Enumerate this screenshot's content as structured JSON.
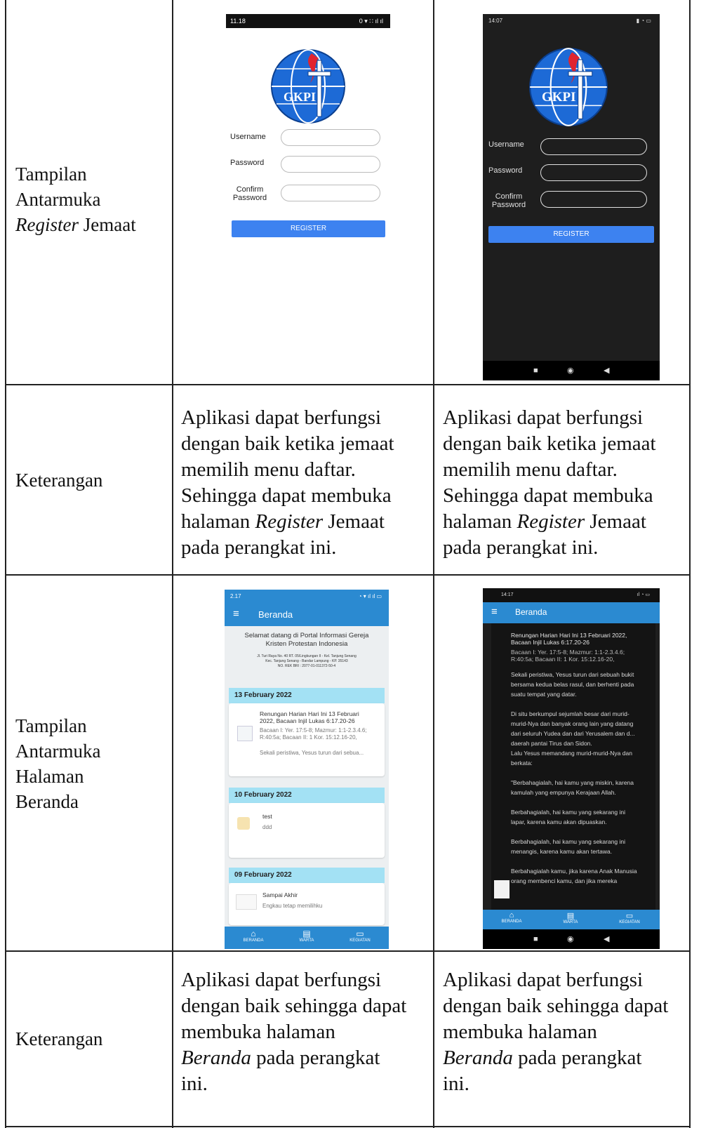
{
  "rows": [
    {
      "label_line1": "Tampilan",
      "label_line2": "Antarmuka",
      "label_line3_italic": "Register",
      "label_line3_rest": " Jemaat"
    },
    {
      "label": "Keterangan",
      "desc_lines": [
        "Aplikasi dapat berfungsi",
        "dengan baik ketika jemaat",
        "memilih menu daftar.",
        "Sehingga dapat membuka"
      ],
      "desc_last_prefix": "halaman ",
      "desc_last_italic": "Register",
      "desc_last_suffix": " Jemaat",
      "desc_final": "pada perangkat ini."
    },
    {
      "label_lines": [
        "Tampilan",
        "Antarmuka",
        "Halaman",
        "Beranda"
      ]
    },
    {
      "label": "Keterangan",
      "desc_lines": [
        "Aplikasi dapat berfungsi",
        "dengan baik sehingga dapat",
        "membuka halaman"
      ],
      "desc_italic": "Beranda",
      "desc_rest": " pada perangkat",
      "desc_final": "ini."
    }
  ],
  "register_light": {
    "status_time": "11.18",
    "status_right": "0 ▾ ∷ ıl ıl",
    "logo_text": "GKPI",
    "username_label": "Username",
    "password_label": "Password",
    "confirm_label_1": "Confirm",
    "confirm_label_2": "Password",
    "button": "REGISTER"
  },
  "register_dark": {
    "status_time": "14:07",
    "logo_text": "GKPI",
    "username_label": "Username",
    "password_label": "Password",
    "confirm_label_1": "Confirm",
    "confirm_label_2": "Password",
    "button": "REGISTER"
  },
  "beranda_light": {
    "status_time": "2.17",
    "title": "Beranda",
    "welcome_1": "Selamat datang di Portal Informasi Gereja",
    "welcome_2": "Kristen Protestan Indonesia",
    "address_1": "Jl. Turi Raya No. 40 RT. 05/Lingkungan II - Kel. Tanjung Senang",
    "address_2": "Kec. Tanjung Senang - Bandar Lampung - KP. 35143",
    "address_3": "NO. REK BRI : 2077-01-011372-50-4",
    "groups": [
      {
        "date": "13 February 2022",
        "title_1": "Renungan Harian Hari Ini 13 Februari",
        "title_2": "2022, Bacaan Injil Lukas 6:17.20-26",
        "sub_1": "Bacaan I: Yer. 17:5-8; Mazmur: 1:1-2.3.4.6;",
        "sub_2": "R:40:5a; Bacaan II: 1 Kor. 15:12.16-20,",
        "sub_3": "Sekali peristiwa, Yesus turun dari sebua..."
      },
      {
        "date": "10 February 2022",
        "title_1": "test",
        "sub_1": "ddd"
      },
      {
        "date": "09 February 2022",
        "title_1": "Sampai Akhir",
        "sub_1": "Engkau tetap memilihku"
      }
    ],
    "nav": [
      "BERANDA",
      "WARTA",
      "KEGIATAN"
    ]
  },
  "beranda_dark": {
    "status_time": "14:17",
    "title": "Beranda",
    "lines": [
      "Renungan Harian Hari Ini 13 Februari 2022,",
      "Bacaan Injil Lukas 6:17.20-26",
      "Bacaan I: Yer. 17:5-8; Mazmur: 1:1-2.3.4.6;",
      "R:40:5a; Bacaan II: 1 Kor. 15:12.16-20,",
      "Sekali peristiwa, Yesus turun dari sebuah bukit",
      "bersama kedua belas rasul, dan berhenti pada",
      "suatu tempat yang datar.",
      "Di situ berkumpul sejumlah besar dari murid-",
      "murid-Nya dan banyak orang lain yang datang",
      "dari seluruh Yudea dan dari Yerusalem dan d...",
      "daerah pantai Tirus dan Sidon.",
      "Lalu Yesus memandang murid-murid-Nya dan",
      "berkata:",
      "\"Berbahagialah, hai kamu yang miskin, karena",
      "kamulah yang empunya Kerajaan Allah.",
      "Berbahagialah, hai kamu yang sekarang ini",
      "lapar, karena kamu akan dipuaskan.",
      "Berbahagialah, hai kamu yang sekarang ini",
      "menangis, karena kamu akan tertawa.",
      "Berbahagialah kamu, jika karena Anak Manusia",
      "orang membenci kamu, dan jika mereka"
    ],
    "nav": [
      "BERANDA",
      "WARTA",
      "KEGIATAN"
    ]
  },
  "colors": {
    "app_blue": "#2b8ad1",
    "button_blue": "#3d82f0",
    "date_bar": "#a3e1f4",
    "dark_bg": "#1e1e1e",
    "grid": "#222222"
  }
}
